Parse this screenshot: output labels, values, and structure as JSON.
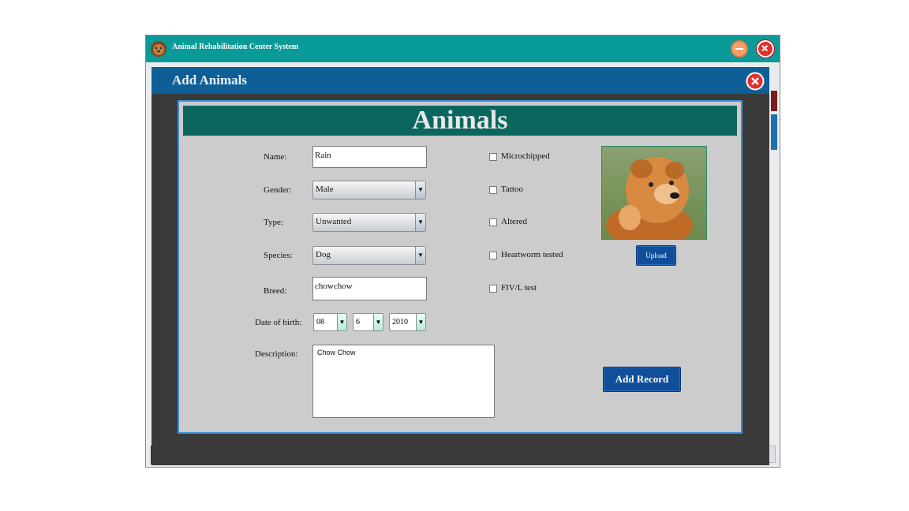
{
  "window": {
    "title": "Animal Rehabilitation Center System"
  },
  "dialog": {
    "title": "Add Animals"
  },
  "panel": {
    "title": "Animals"
  },
  "form": {
    "name": {
      "label": "Name:",
      "value": "Rain"
    },
    "gender": {
      "label": "Gender:",
      "value": "Male"
    },
    "type": {
      "label": "Type:",
      "value": "Unwanted"
    },
    "species": {
      "label": "Species:",
      "value": "Dog"
    },
    "breed": {
      "label": "Breed:",
      "value": "chowchow"
    },
    "dob": {
      "label": "Date of birth:",
      "day": "08",
      "month": "6",
      "year": "2010"
    },
    "description": {
      "label": "Description:",
      "value": "Chow Chow"
    }
  },
  "checkboxes": [
    {
      "label": "Microchipped",
      "checked": false
    },
    {
      "label": "Tattoo",
      "checked": false
    },
    {
      "label": "Altered",
      "checked": false
    },
    {
      "label": "Heartworm tested",
      "checked": false
    },
    {
      "label": "FIV/L test",
      "checked": false
    }
  ],
  "buttons": {
    "upload": "Upload",
    "add_record": "Add Record"
  },
  "photo": {
    "subject": "chow-chow-dog-photo"
  },
  "colors": {
    "titlebar": "#0a9a98",
    "dialog_header": "#0f5f97",
    "panel_header": "#0c6660",
    "button": "#0f4f9a"
  }
}
